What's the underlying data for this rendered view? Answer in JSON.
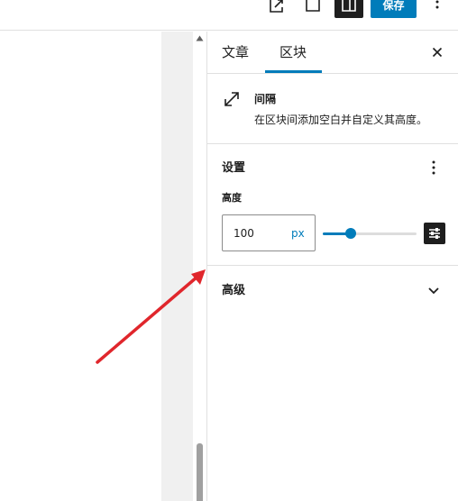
{
  "toolbar": {
    "save_label": "保存",
    "icons": [
      "external-link-icon",
      "trash-icon",
      "settings-sidebar-icon",
      "more-vertical-icon"
    ]
  },
  "sidebar": {
    "tabs": [
      {
        "label": "文章",
        "active": false
      },
      {
        "label": "区块",
        "active": true
      }
    ],
    "close_icon": "close-icon",
    "block": {
      "icon": "resize-icon",
      "title": "间隔",
      "description": "在区块间添加空白并自定义其高度。"
    },
    "settings": {
      "title": "设置",
      "height_label": "高度",
      "height_value": "100",
      "unit": "px",
      "slider_fraction": 0.3
    },
    "advanced": {
      "title": "高级"
    }
  },
  "colors": {
    "accent": "#007cba",
    "dark": "#1e1e1e",
    "arrow": "#e0262c",
    "gutter": "#f0f0f0"
  }
}
